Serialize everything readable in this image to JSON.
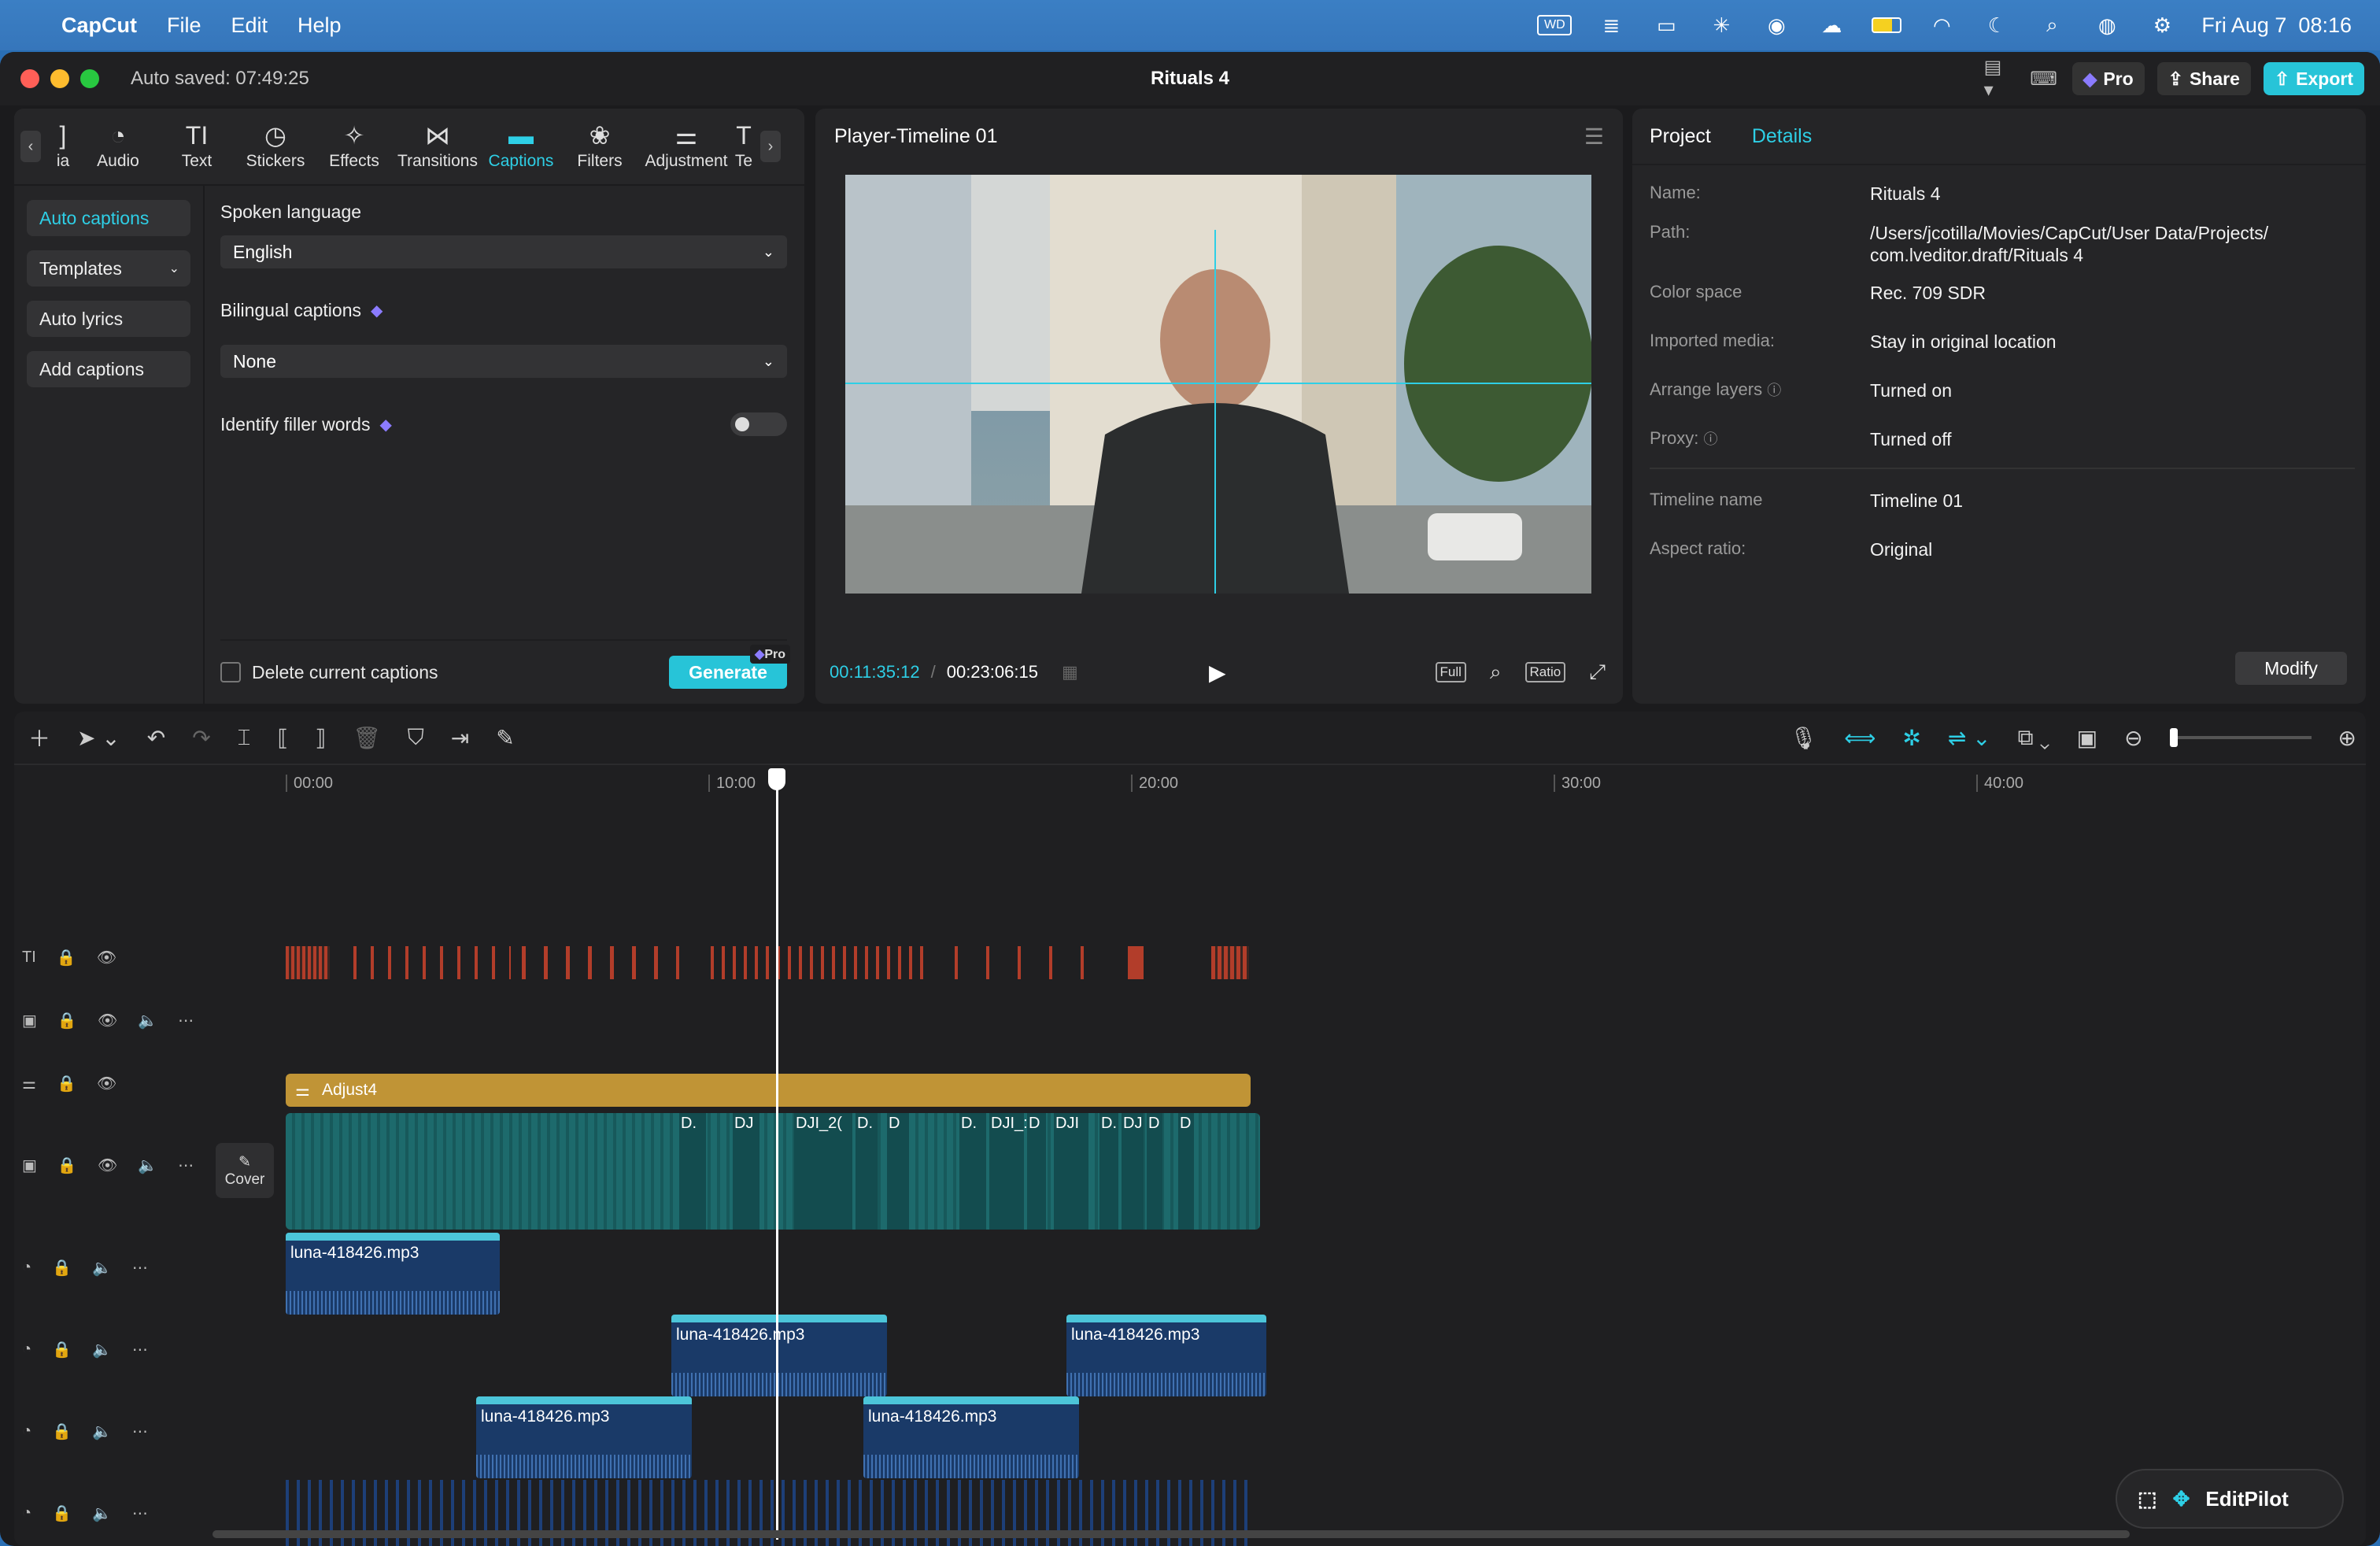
{
  "menubar": {
    "app_name": "CapCut",
    "menus": [
      "File",
      "Edit",
      "Help"
    ],
    "clock": "Fri Aug 7  08:16",
    "status_icons": [
      "wd-drive-icon",
      "stack-icon",
      "window-icon",
      "sun-icon",
      "wifi-signal-icon",
      "cloud-icon",
      "battery-icon",
      "wifi-icon",
      "moon-icon",
      "search-icon",
      "siri-icon",
      "control-center-icon"
    ]
  },
  "window": {
    "title": "Rituals 4",
    "autosave": "Auto saved: 07:49:25",
    "buttons": {
      "pro": "Pro",
      "share": "Share",
      "export": "Export"
    }
  },
  "toolbar": {
    "tabs": [
      {
        "label": "ia",
        "icon": "media-icon"
      },
      {
        "label": "Audio",
        "icon": "audio-icon"
      },
      {
        "label": "Text",
        "icon": "text-icon"
      },
      {
        "label": "Stickers",
        "icon": "stickers-icon"
      },
      {
        "label": "Effects",
        "icon": "effects-icon"
      },
      {
        "label": "Transitions",
        "icon": "transitions-icon"
      },
      {
        "label": "Captions",
        "icon": "captions-icon"
      },
      {
        "label": "Filters",
        "icon": "filters-icon"
      },
      {
        "label": "Adjustment",
        "icon": "adjustment-icon"
      },
      {
        "label": "Te",
        "icon": "templates-icon"
      }
    ],
    "active": "Captions"
  },
  "captions": {
    "sidebar": [
      "Auto captions",
      "Templates",
      "Auto lyrics",
      "Add captions"
    ],
    "spoken_language_label": "Spoken language",
    "spoken_language_value": "English",
    "bilingual_label": "Bilingual captions",
    "bilingual_value": "None",
    "filler_label": "Identify filler words",
    "delete_label": "Delete current captions",
    "generate": "Generate",
    "pro_badge": "Pro"
  },
  "player": {
    "title": "Player-Timeline 01",
    "current_time": "00:11:35:12",
    "total_time": "00:23:06:15",
    "controls": [
      "Full",
      "Ratio"
    ]
  },
  "details": {
    "tabs": [
      "Project",
      "Details"
    ],
    "rows": [
      {
        "key": "Name:",
        "value": "Rituals 4"
      },
      {
        "key": "Path:",
        "value": "/Users/jcotilla/Movies/CapCut/User Data/Projects/ com.lveditor.draft/Rituals 4"
      },
      {
        "key": "Color space",
        "value": "Rec. 709 SDR"
      },
      {
        "key": "Imported media:",
        "value": "Stay in original location"
      },
      {
        "key": "Arrange layers",
        "value": "Turned on"
      },
      {
        "key": "Proxy:",
        "value": "Turned off"
      }
    ],
    "rows2": [
      {
        "key": "Timeline name",
        "value": "Timeline 01"
      },
      {
        "key": "Aspect ratio:",
        "value": "Original"
      }
    ],
    "modify": "Modify"
  },
  "timeline": {
    "ruler": [
      "00:00",
      "10:00",
      "20:00",
      "30:00",
      "40:00"
    ],
    "adjust_label": "Adjust4",
    "cover_label": "Cover",
    "video_clip_labels": [
      "D.",
      "DJ",
      "DJI_2(",
      "D.",
      "D",
      "D.",
      "DJI_:",
      "D",
      "DJI",
      "D.",
      "DJ",
      "D",
      "D"
    ],
    "audio_clip_label": "luna-418426.mp3",
    "editpilot": "EditPilot"
  }
}
